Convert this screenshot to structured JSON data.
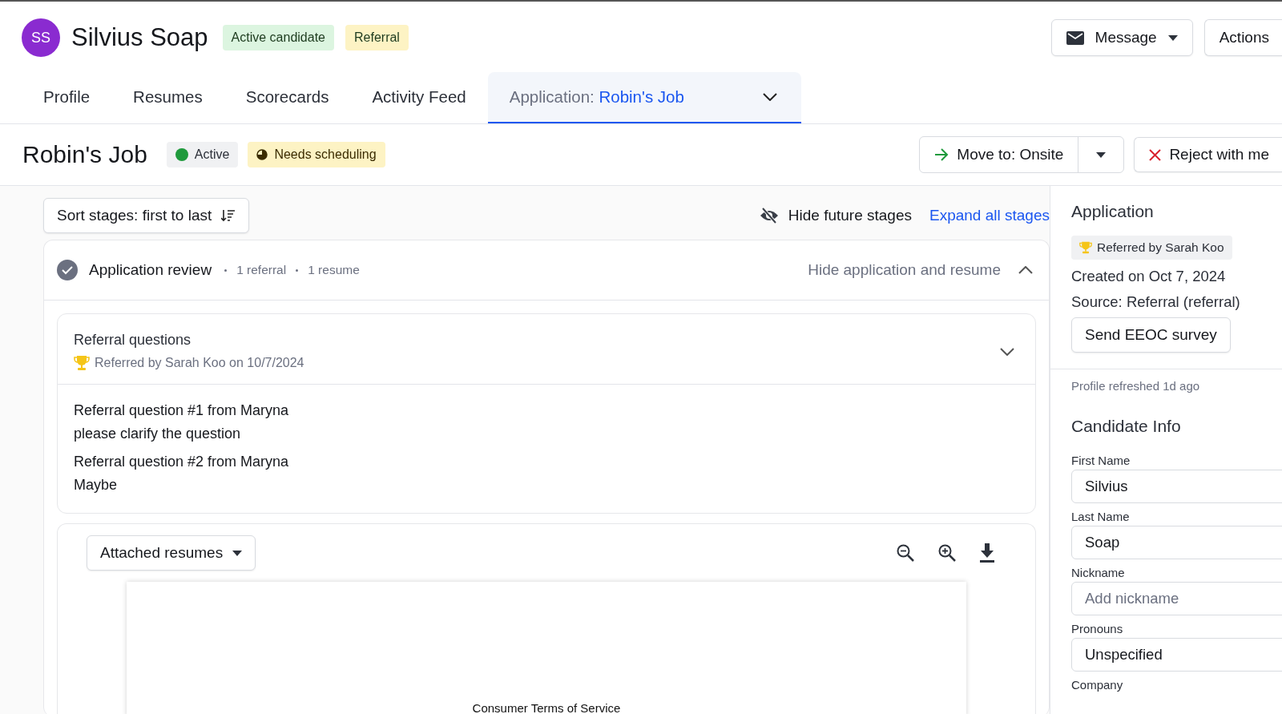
{
  "candidate": {
    "initials": "SS",
    "name": "Silvius Soap",
    "tags": [
      {
        "label": "Active candidate",
        "color": "#dcf5e0"
      },
      {
        "label": "Referral",
        "color": "#fdf3c4"
      }
    ]
  },
  "header_actions": [
    {
      "label": "Message",
      "kind": "mail-dropdown"
    },
    {
      "label": "Actions",
      "kind": "plain"
    }
  ],
  "tabs": [
    {
      "label": "Profile",
      "selected": false
    },
    {
      "label": "Resumes",
      "selected": false
    },
    {
      "label": "Scorecards",
      "selected": false
    },
    {
      "label": "Activity Feed",
      "selected": false
    },
    {
      "label": "Application:",
      "detail": "Robin's Job",
      "selected": true
    }
  ],
  "job": {
    "title": "Robin's Job",
    "statuses": [
      {
        "label": "Active",
        "kind": "dot",
        "color": "#1f9a3c"
      },
      {
        "label": "Needs scheduling",
        "kind": "clock",
        "color": "#fdf3c4"
      }
    ],
    "move_button": "Move to: Onsite",
    "reject_button": "Reject with me"
  },
  "toolbar": {
    "sort": "Sort stages: first to last",
    "hide_future": "Hide future stages",
    "expand": "Expand all stages"
  },
  "stage": {
    "name": "Application review",
    "completed": true,
    "meta": [
      "1 referral",
      "1 resume"
    ],
    "hide_link": "Hide application and resume",
    "referral": {
      "title": "Referral questions",
      "subtitle": "Referred by Sarah Koo on 10/7/2024",
      "questions": [
        {
          "question": "Referral question #1 from Maryna",
          "answer": "please clarify the question"
        },
        {
          "question": "Referral question #2 from Maryna",
          "answer": "Maybe"
        }
      ]
    },
    "resumes": {
      "dropdown": "Attached resumes",
      "document_title": "Consumer Terms of Service"
    }
  },
  "application_panel": {
    "title": "Application",
    "referred_chip": "Referred by Sarah Koo",
    "created": "Created on Oct 7, 2024",
    "source": "Source: Referral (referral)",
    "eeoc_button": "Send EEOC survey"
  },
  "refreshed": "Profile refreshed 1d ago",
  "candidate_info": {
    "title": "Candidate Info",
    "fields": [
      {
        "label": "First Name",
        "value": "Silvius"
      },
      {
        "label": "Last Name",
        "value": "Soap"
      },
      {
        "label": "Nickname",
        "placeholder": "Add nickname"
      },
      {
        "label": "Pronouns",
        "value": "Unspecified"
      }
    ],
    "next_label": "Company"
  }
}
